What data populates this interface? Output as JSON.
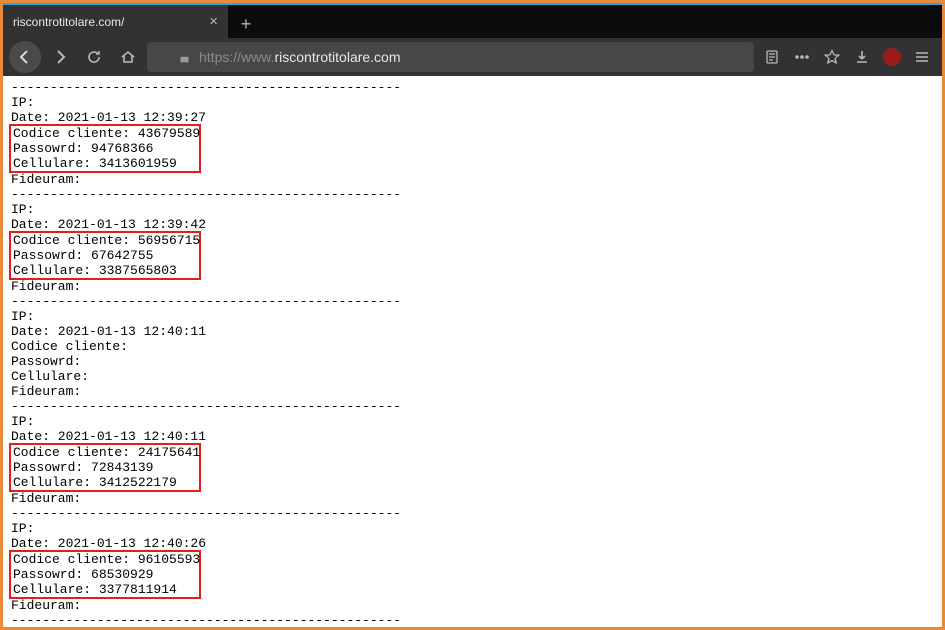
{
  "tab": {
    "title": "riscontrotitolare.com/"
  },
  "url": {
    "prefix": "https://www.",
    "domain": "riscontrotitolare.com"
  },
  "sep": "--------------------------------------------------",
  "labels": {
    "ip": "IP:",
    "date": "Date:",
    "codice": "Codice cliente:",
    "passowrd": "Passowrd:",
    "cellulare": "Cellulare:",
    "fideuram": "Fideuram:"
  },
  "records": [
    {
      "date": "2021-01-13 12:39:27",
      "codice": "43679589",
      "passowrd": "94768366",
      "cellulare": "3413601959",
      "boxed": true
    },
    {
      "date": "2021-01-13 12:39:42",
      "codice": "56956715",
      "passowrd": "67642755",
      "cellulare": "3387565803",
      "boxed": true
    },
    {
      "date": "2021-01-13 12:40:11",
      "codice": "",
      "passowrd": "",
      "cellulare": "",
      "boxed": false
    },
    {
      "date": "2021-01-13 12:40:11",
      "codice": "24175641",
      "passowrd": "72843139",
      "cellulare": "3412522179",
      "boxed": true
    },
    {
      "date": "2021-01-13 12:40:26",
      "codice": "96105593",
      "passowrd": "68530929",
      "cellulare": "3377811914",
      "boxed": true
    }
  ]
}
